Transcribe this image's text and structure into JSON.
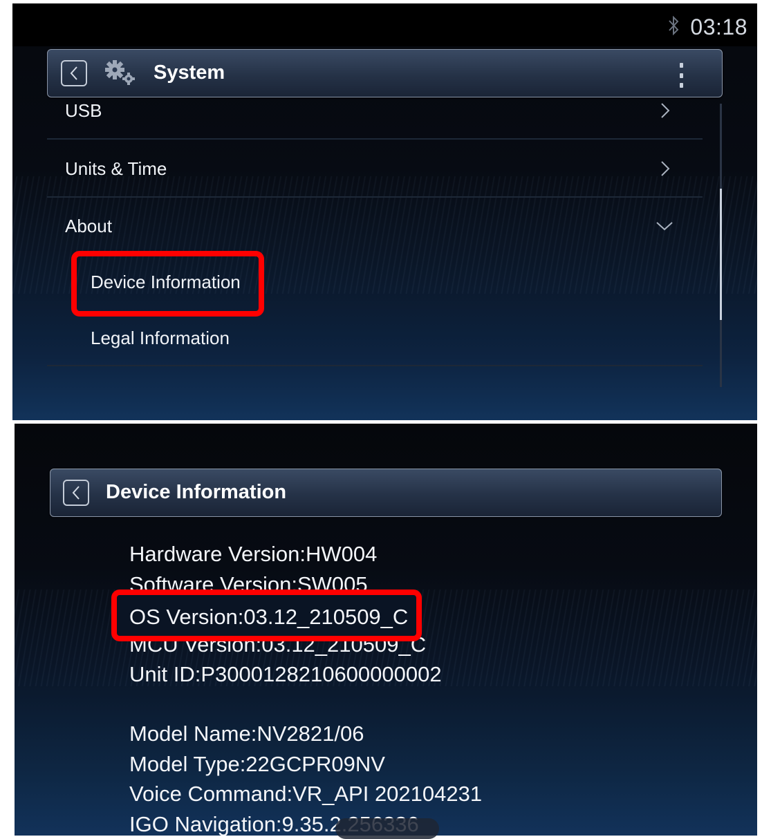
{
  "status_bar": {
    "time": "03:18",
    "bluetooth_icon": "bluetooth-icon"
  },
  "system_screen": {
    "title": "System",
    "icons": {
      "back": "chevron-left-icon",
      "settings": "gears-icon",
      "menu": "vertical-dots-icon"
    },
    "items": [
      {
        "label": "USB",
        "icon": "chevron-right-icon"
      },
      {
        "label": "Units & Time",
        "icon": "chevron-right-icon"
      },
      {
        "label": "About",
        "icon": "chevron-down-icon",
        "expanded": true
      }
    ],
    "about_subitems": [
      {
        "label": "Device Information",
        "highlighted": true
      },
      {
        "label": "Legal Information",
        "highlighted": false
      }
    ]
  },
  "device_info_screen": {
    "title": "Device Information",
    "lines": [
      "Hardware Version:HW004",
      "Software Version:SW005",
      "OS Version:03.12_210509_C",
      "MCU Version:03.12_210509_C",
      "Unit ID:P3000128210600000002",
      "Model Name:NV2821/06",
      "Model Type:22GCPR09NV",
      "Voice Command:VR_API 202104231",
      "IGO Navigation:9.35.2.256336"
    ],
    "highlighted_line": "OS Version:03.12_210509_C"
  },
  "colors": {
    "highlight": "#ff0000",
    "background": "#070b13",
    "header": "#2a3850"
  }
}
